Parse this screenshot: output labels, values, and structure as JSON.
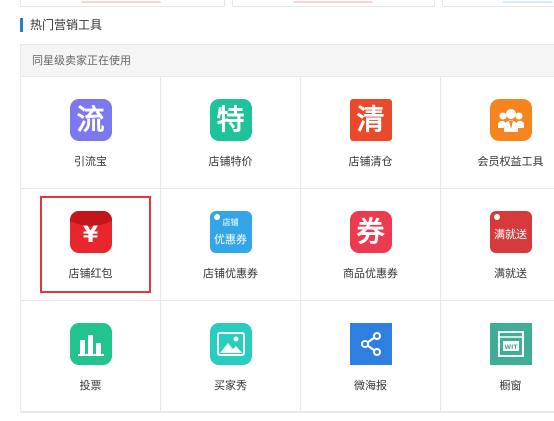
{
  "section": {
    "title": "热门营销工具",
    "subheader": "同星级卖家正在使用"
  },
  "colors": {
    "accent": "#2d7bd1",
    "selection": "#e2373f"
  },
  "tools": [
    {
      "label": "引流宝",
      "icon": "liu-character-icon",
      "glyph": "流",
      "color": "#7c78f0"
    },
    {
      "label": "店铺特价",
      "icon": "te-character-icon",
      "glyph": "特",
      "color": "#1fc39a"
    },
    {
      "label": "店铺清仓",
      "icon": "qing-character-icon",
      "glyph": "清",
      "color": "#ea4a2b"
    },
    {
      "label": "会员权益工具",
      "icon": "members-icon",
      "glyph": "",
      "color": "#f7851f"
    },
    {
      "label": "店铺红包",
      "icon": "red-envelope-yen-icon",
      "glyph": "¥",
      "color": "#e8262d",
      "selected": true
    },
    {
      "label": "店铺优惠券",
      "icon": "coupon-tag-icon",
      "glyph": "",
      "tag_top": "店铺",
      "tag_bottom": "优惠券",
      "color": "#34a5e6"
    },
    {
      "label": "商品优惠券",
      "icon": "quan-character-icon",
      "glyph": "券",
      "color": "#ee3a4e"
    },
    {
      "label": "满就送",
      "icon": "full-gift-tag-icon",
      "glyph": "",
      "tag_bottom": "满就送",
      "color": "#d63a3a"
    },
    {
      "label": "投票",
      "icon": "bar-chart-icon",
      "glyph": "",
      "color": "#22c38f"
    },
    {
      "label": "买家秀",
      "icon": "picture-icon",
      "glyph": "",
      "color": "#27cdbe"
    },
    {
      "label": "微海报",
      "icon": "share-nodes-icon",
      "glyph": "",
      "color": "#2f7fe0"
    },
    {
      "label": "橱窗",
      "icon": "showcase-window-icon",
      "glyph": "",
      "window_text": "WIT",
      "color": "#3fae96"
    }
  ]
}
